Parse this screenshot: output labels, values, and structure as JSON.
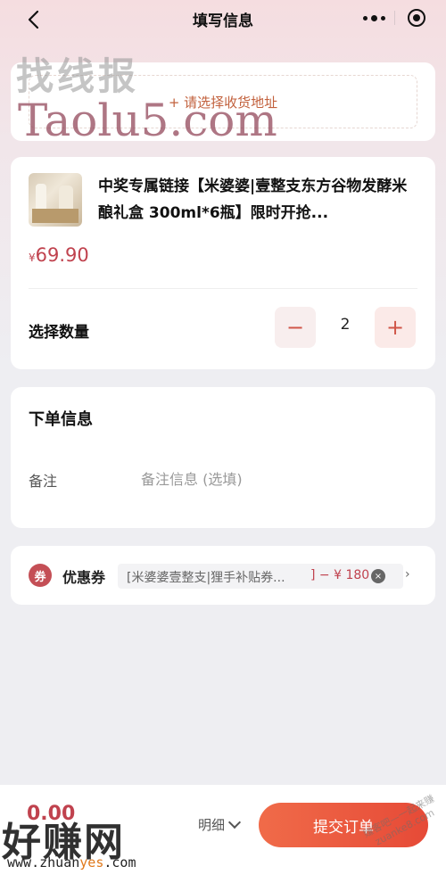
{
  "nav": {
    "title": "填写信息"
  },
  "address": {
    "placeholder": "+ 请选择收货地址"
  },
  "product": {
    "title": "中奖专属链接【米婆婆|壹整支东方谷物发酵米酿礼盒 300ml*6瓶】限时开抢...",
    "currency": "¥",
    "price": "69.90",
    "quantity_label": "选择数量",
    "quantity": "2",
    "minus": "−",
    "plus": "+"
  },
  "order_info": {
    "title": "下单信息",
    "note_label": "备注",
    "note_placeholder": "备注信息 (选填)"
  },
  "coupon": {
    "icon_text": "券",
    "label": "优惠券",
    "name": "[米婆婆壹整支|狸手补贴券...",
    "discount": "] − ¥ 180",
    "clear": "×",
    "arrow": "›"
  },
  "bottom": {
    "total": "0.00",
    "detail": "明细",
    "submit": "提交订单"
  },
  "watermarks": {
    "top_cn": "找线报",
    "top_en": "Taolu5.com",
    "bottom_cn": "好赚网",
    "bottom_url_a": "www.zhuan",
    "bottom_url_b": "yes",
    "bottom_url_c": ".com",
    "diag": "赚客吧—一起来赚 zuanke8.com"
  },
  "colors": {
    "accent": "#c0424e",
    "submit": "#e64a37",
    "address_text": "#c2613d"
  }
}
